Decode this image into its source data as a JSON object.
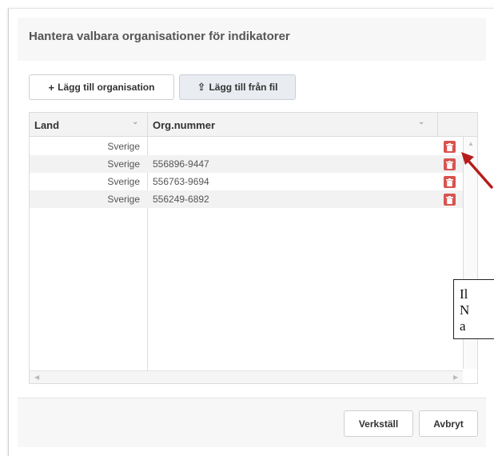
{
  "dialog": {
    "title": "Hantera valbara organisationer för indikatorer"
  },
  "toolbar": {
    "add_org_icon": "plus-icon",
    "add_org_glyph": "+",
    "add_org_label": "Lägg till organisation",
    "add_file_icon": "upload-icon",
    "add_file_glyph": "⇪",
    "add_file_label": "Lägg till från fil"
  },
  "grid": {
    "columns": [
      {
        "label": "Land",
        "sort_icon": "chevron-down-icon",
        "sort_glyph": "⌄"
      },
      {
        "label": "Org.nummer",
        "sort_icon": "chevron-down-icon",
        "sort_glyph": "⌄"
      }
    ],
    "rows": [
      {
        "land": "Sverige",
        "org": ""
      },
      {
        "land": "Sverige",
        "org": "556896-9447"
      },
      {
        "land": "Sverige",
        "org": "556763-9694"
      },
      {
        "land": "Sverige",
        "org": "556249-6892"
      }
    ],
    "delete_icon": "trash-icon",
    "scroll_up_glyph": "▲",
    "scroll_left_glyph": "◀",
    "scroll_right_glyph": "▶"
  },
  "footer": {
    "apply_label": "Verkställ",
    "cancel_label": "Avbryt"
  },
  "overlay": {
    "lines": [
      "Il",
      "N",
      "a"
    ]
  },
  "colors": {
    "delete_button": "#d9534f",
    "annotation_arrow": "#b71c1c"
  }
}
